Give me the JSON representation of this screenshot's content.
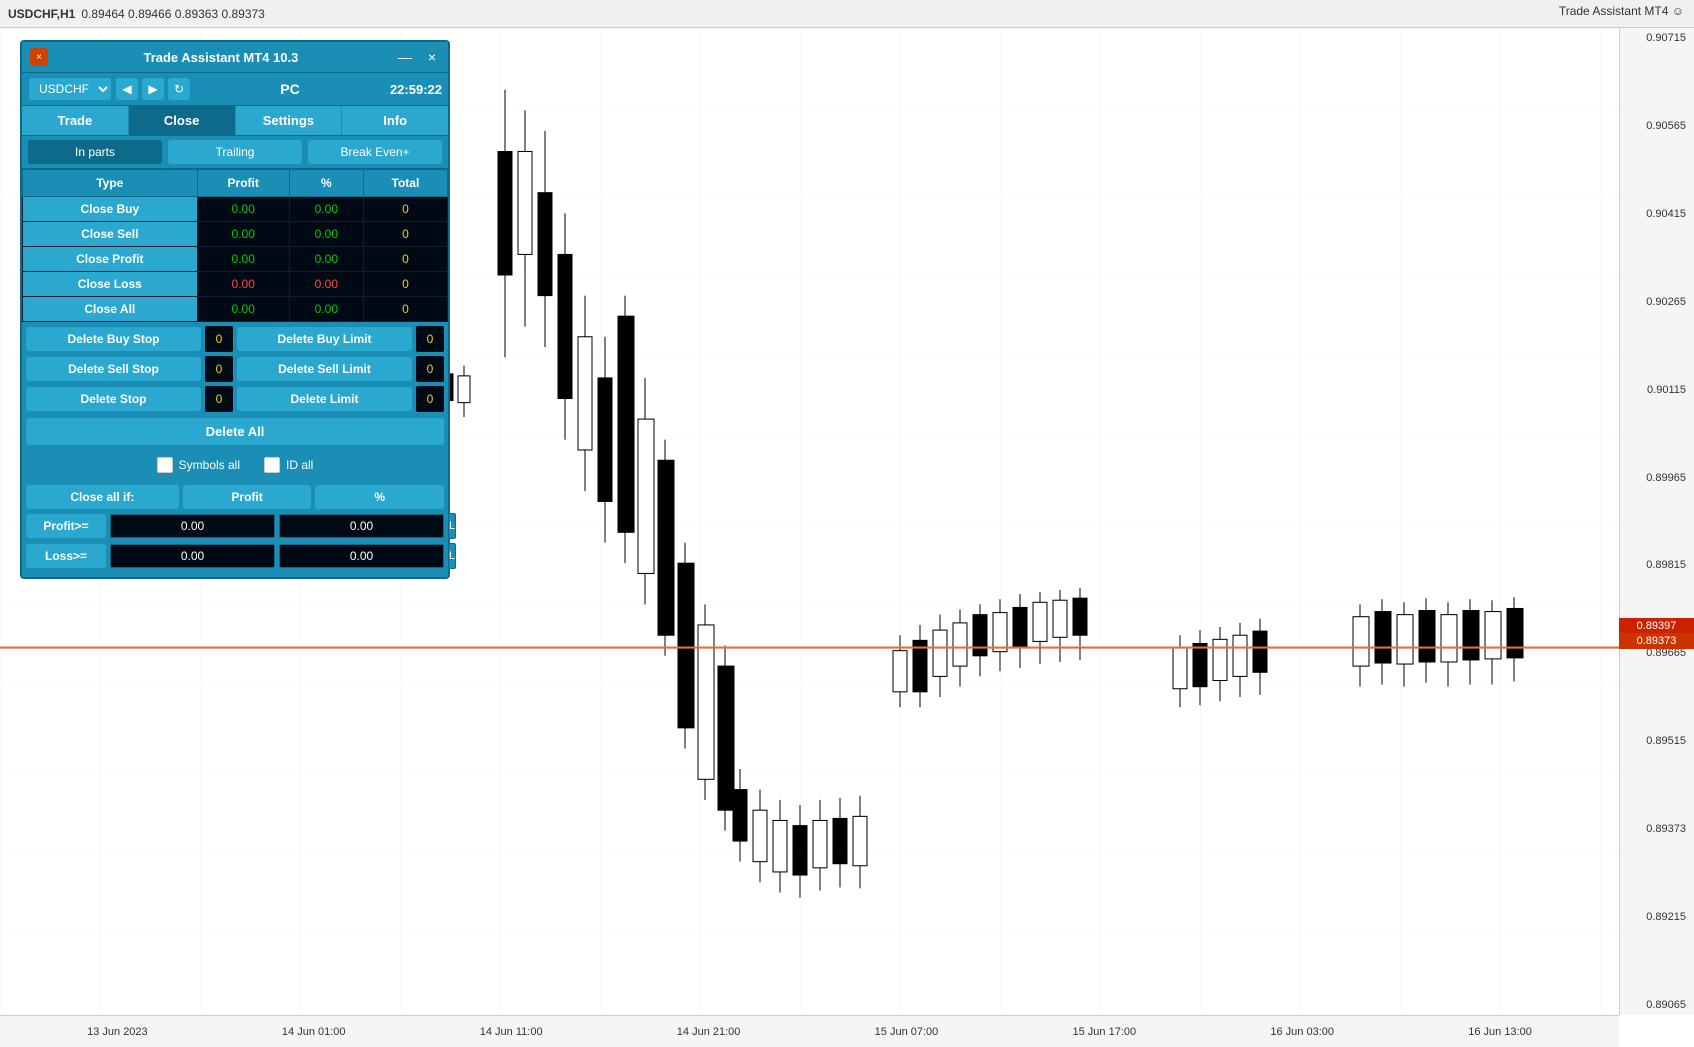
{
  "chart": {
    "symbol": "USDCHF,H1",
    "ohlc": "0.89464 0.89466 0.89363 0.89373",
    "top_right_label": "Trade Assistant MT4",
    "price_levels": [
      "0.90715",
      "0.90565",
      "0.90415",
      "0.90265",
      "0.90115",
      "0.89965",
      "0.89815",
      "0.89665",
      "0.89515",
      "0.89373",
      "0.89215",
      "0.89065"
    ],
    "current_price_1": "0.89397",
    "current_price_2": "0.89373",
    "time_labels": [
      "13 Jun 2023",
      "14 Jun 01:00",
      "14 Jun 11:00",
      "14 Jun 21:00",
      "15 Jun 07:00",
      "15 Jun 17:00",
      "16 Jun 03:00",
      "16 Jun 13:00"
    ]
  },
  "panel": {
    "title": "Trade Assistant MT4 10.3",
    "minimize_label": "—",
    "close_label": "×",
    "symbol": "USDCHF",
    "mode": "PC",
    "time": "22:59:22",
    "tabs": {
      "main": [
        "Trade",
        "Close",
        "Settings",
        "Info"
      ],
      "active_main": 1,
      "sub": [
        "In parts",
        "Trailing",
        "Break Even+"
      ],
      "active_sub": 0
    },
    "table": {
      "headers": [
        "Type",
        "Profit",
        "%",
        "Total"
      ],
      "rows": [
        {
          "label": "Close Buy",
          "profit": "0.00",
          "percent": "0.00",
          "total": "0",
          "profit_color": "green",
          "percent_color": "green",
          "total_color": "yellow"
        },
        {
          "label": "Close Sell",
          "profit": "0.00",
          "percent": "0.00",
          "total": "0",
          "profit_color": "green",
          "percent_color": "green",
          "total_color": "yellow"
        },
        {
          "label": "Close Profit",
          "profit": "0.00",
          "percent": "0.00",
          "total": "0",
          "profit_color": "green",
          "percent_color": "green",
          "total_color": "yellow"
        },
        {
          "label": "Close Loss",
          "profit": "0.00",
          "percent": "0.00",
          "total": "0",
          "profit_color": "red",
          "percent_color": "red",
          "total_color": "yellow"
        },
        {
          "label": "Close All",
          "profit": "0.00",
          "percent": "0.00",
          "total": "0",
          "profit_color": "green",
          "percent_color": "green",
          "total_color": "yellow"
        }
      ]
    },
    "delete_section": {
      "rows": [
        {
          "left_label": "Delete Buy Stop",
          "left_count": "0",
          "right_label": "Delete Buy Limit",
          "right_count": "0"
        },
        {
          "left_label": "Delete Sell Stop",
          "left_count": "0",
          "right_label": "Delete Sell Limit",
          "right_count": "0"
        },
        {
          "left_label": "Delete Stop",
          "left_count": "0",
          "right_label": "Delete Limit",
          "right_count": "0"
        }
      ],
      "delete_all": "Delete All"
    },
    "checkboxes": {
      "symbols_all": "Symbols all",
      "id_all": "ID all"
    },
    "close_all_if": {
      "header": "Close all if:",
      "profit_label": "Profit",
      "percent_label": "%",
      "profit_gte_label": "Profit>=",
      "profit_gte_val1": "0.00",
      "profit_gte_val2": "0.00",
      "loss_gte_label": "Loss>=",
      "loss_gte_val1": "0.00",
      "loss_gte_val2": "0.00",
      "l_label": "L"
    }
  }
}
